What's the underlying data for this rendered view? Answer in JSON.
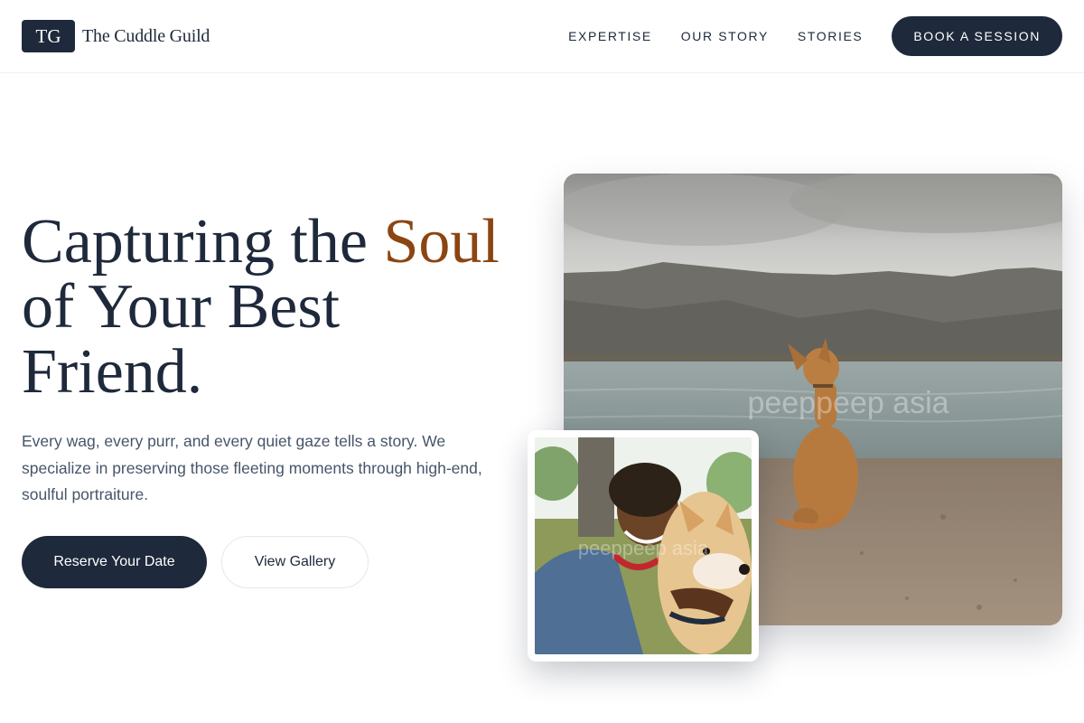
{
  "brand": {
    "mark": "TG",
    "name": "The Cuddle Guild"
  },
  "nav": {
    "items": [
      {
        "label": "EXPERTISE"
      },
      {
        "label": "OUR STORY"
      },
      {
        "label": "STORIES"
      }
    ],
    "cta": "BOOK A SESSION"
  },
  "hero": {
    "headline_part1": "Capturing the ",
    "headline_accent": "Soul",
    "headline_part2": "of Your Best",
    "headline_part3": "Friend.",
    "subtext": "Every wag, every purr, and every quiet gaze tells a story. We specialize in preserving those fleeting moments through high-end, soulful portraiture.",
    "primary_button": "Reserve Your Date",
    "secondary_button": "View Gallery"
  },
  "images": {
    "main_watermark": "peeppeep asia",
    "inset_watermark": "peeppeep asia"
  },
  "colors": {
    "navy": "#1e293b",
    "accent": "#8b4513",
    "body_text": "#475569"
  }
}
